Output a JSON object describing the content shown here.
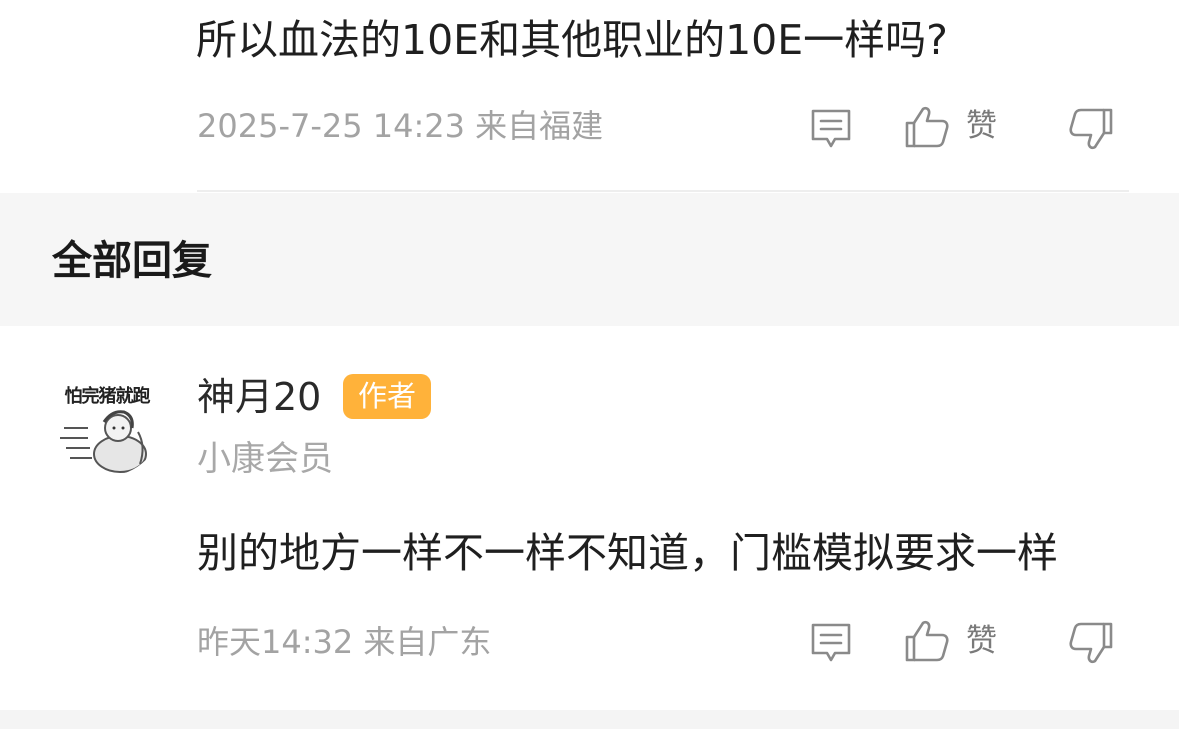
{
  "previous_comment": {
    "text": "所以血法的10E和其他职业的10E一样吗?",
    "meta": "2025-7-25 14:23 来自福建",
    "like_label": "赞"
  },
  "section": {
    "title": "全部回复"
  },
  "reply": {
    "avatar_caption": "怕完猪就跑",
    "username": "神月20",
    "badge": "作者",
    "member_level": "小康会员",
    "text": "别的地方一样不一样不知道，门槛模拟要求一样",
    "meta": "昨天14:32 来自广东",
    "like_label": "赞"
  },
  "icons": {
    "comment": "comment-icon",
    "like": "thumbs-up-icon",
    "dislike": "thumbs-down-icon"
  },
  "colors": {
    "badge": "#ffb23a",
    "meta": "#a3a3a3",
    "section_bg": "#f6f6f6"
  }
}
